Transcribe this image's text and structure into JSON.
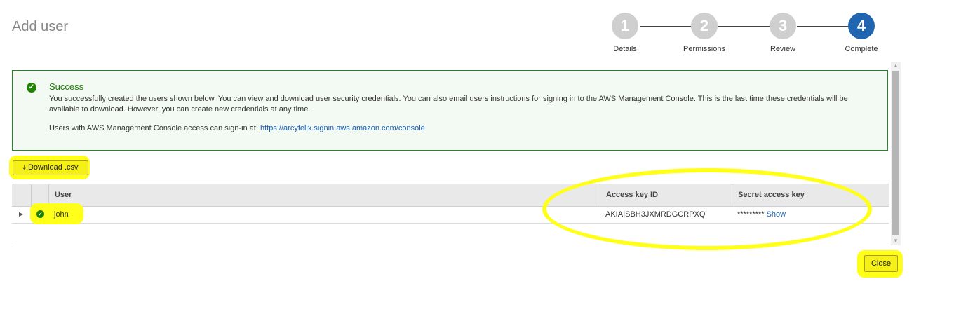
{
  "header": {
    "title": "Add user"
  },
  "steps": [
    {
      "number": "1",
      "label": "Details"
    },
    {
      "number": "2",
      "label": "Permissions"
    },
    {
      "number": "3",
      "label": "Review"
    },
    {
      "number": "4",
      "label": "Complete"
    }
  ],
  "success": {
    "heading": "Success",
    "message": "You successfully created the users shown below. You can view and download user security credentials. You can also email users instructions for signing in to the AWS Management Console. This is the last time these credentials will be available to download. However, you can create new credentials at any time.",
    "signin_text": "Users with AWS Management Console access can sign-in at:",
    "signin_url": "https://arcyfelix.signin.aws.amazon.com/console"
  },
  "actions": {
    "download_label": "Download .csv",
    "close_label": "Close"
  },
  "table": {
    "columns": [
      "User",
      "Access key ID",
      "Secret access key"
    ],
    "rows": [
      {
        "user": "john",
        "access_key_id": "AKIAISBH3JXMRDGCRPXQ",
        "secret_masked": "*********",
        "secret_action": "Show"
      }
    ]
  },
  "colors": {
    "accent": "#1f65b0",
    "success": "#1d8102",
    "highlight": "#ffff1a"
  }
}
